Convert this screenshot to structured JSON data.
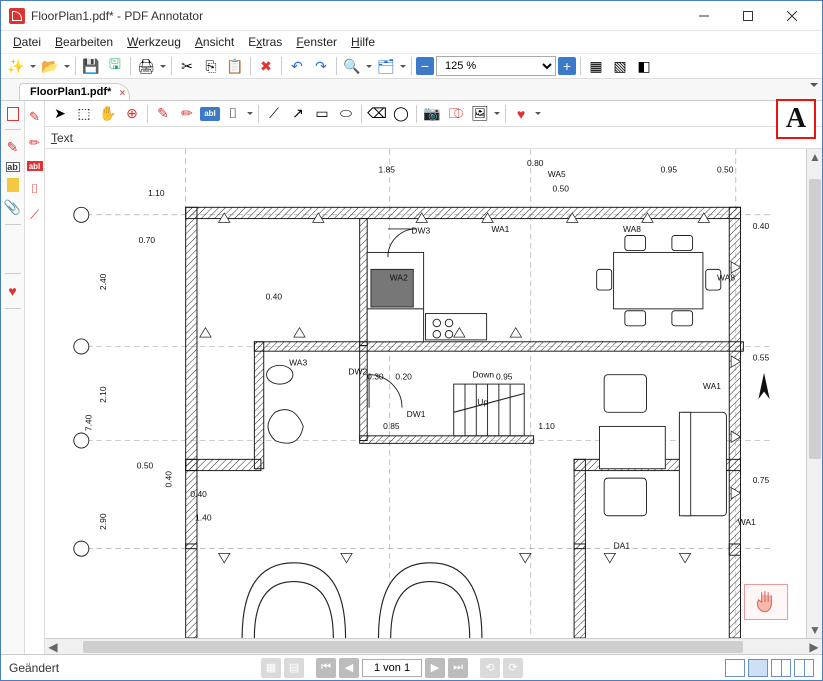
{
  "window": {
    "title": "FloorPlan1.pdf* - PDF Annotator"
  },
  "menus": {
    "file": "Datei",
    "edit": "Bearbeiten",
    "tool": "Werkzeug",
    "view": "Ansicht",
    "extras": "Extras",
    "window": "Fenster",
    "help": "Hilfe"
  },
  "toolbar": {
    "zoom_value": "125 %"
  },
  "tabs": {
    "active": "FloorPlan1.pdf*"
  },
  "sub": {
    "text_label": "Text"
  },
  "status": {
    "modified": "Geändert",
    "page_display": "1 von 1"
  },
  "plan": {
    "labels": {
      "wa1": "WA1",
      "wa2": "WA2",
      "wa3": "WA3",
      "wa5": "WA5",
      "wa8": "WA8",
      "da1": "DA1",
      "dw1": "DW1",
      "dw2": "DW2",
      "dw3": "DW3",
      "down": "Down",
      "up": "Up"
    },
    "dims": {
      "d040a": "0.40",
      "d040b": "0.40",
      "d040c": "0.40",
      "d040d": "0.40",
      "d050a": "0.50",
      "d050b": "0.50",
      "d050c": "0.50",
      "d055": "0.55",
      "d070": "0.70",
      "d075": "0.75",
      "d080": "0.80",
      "d085": "0.85",
      "d095a": "0.95",
      "d095b": "0.95",
      "d110a": "1.10",
      "d110b": "1.10",
      "d140": "1.40",
      "d185": "1.85",
      "d210": "2.10",
      "d240": "2.40",
      "d290": "2.90",
      "d740": "7.40",
      "d020": "0.20",
      "d030": "0.30"
    }
  }
}
